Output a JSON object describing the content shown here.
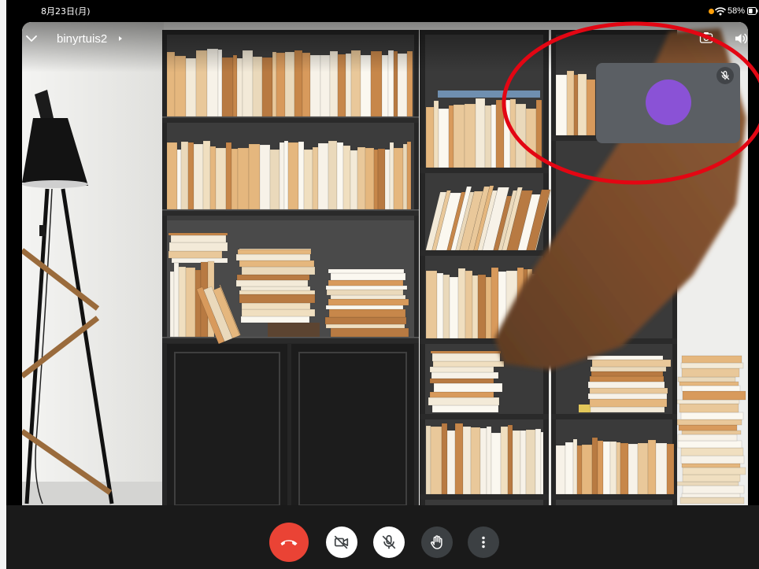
{
  "status_bar": {
    "date": "8月23日(月)",
    "battery_percent": "58%",
    "battery_level": 0.58,
    "indicator_dot_color": "#ff9f0a",
    "icons": [
      "wifi-icon",
      "battery-icon"
    ]
  },
  "call_header": {
    "participant_name": "binyrtuis2",
    "icons": [
      "chevron-down-icon",
      "chevron-right-icon",
      "switch-camera-icon",
      "speaker-icon"
    ]
  },
  "self_view": {
    "avatar_color": "#8a52d6",
    "mic_muted": true,
    "icon": "mic-off-icon"
  },
  "controls": [
    {
      "icon": "end-call-icon",
      "color": "#ea4335"
    },
    {
      "icon": "camera-off-icon",
      "color": "#ffffff",
      "active": false
    },
    {
      "icon": "mic-off-icon",
      "color": "#ffffff",
      "active": false
    },
    {
      "icon": "raise-hand-icon",
      "color": "#3c4043"
    },
    {
      "icon": "more-vert-icon",
      "color": "#3c4043"
    }
  ],
  "annotation": {
    "color": "#e30613"
  }
}
